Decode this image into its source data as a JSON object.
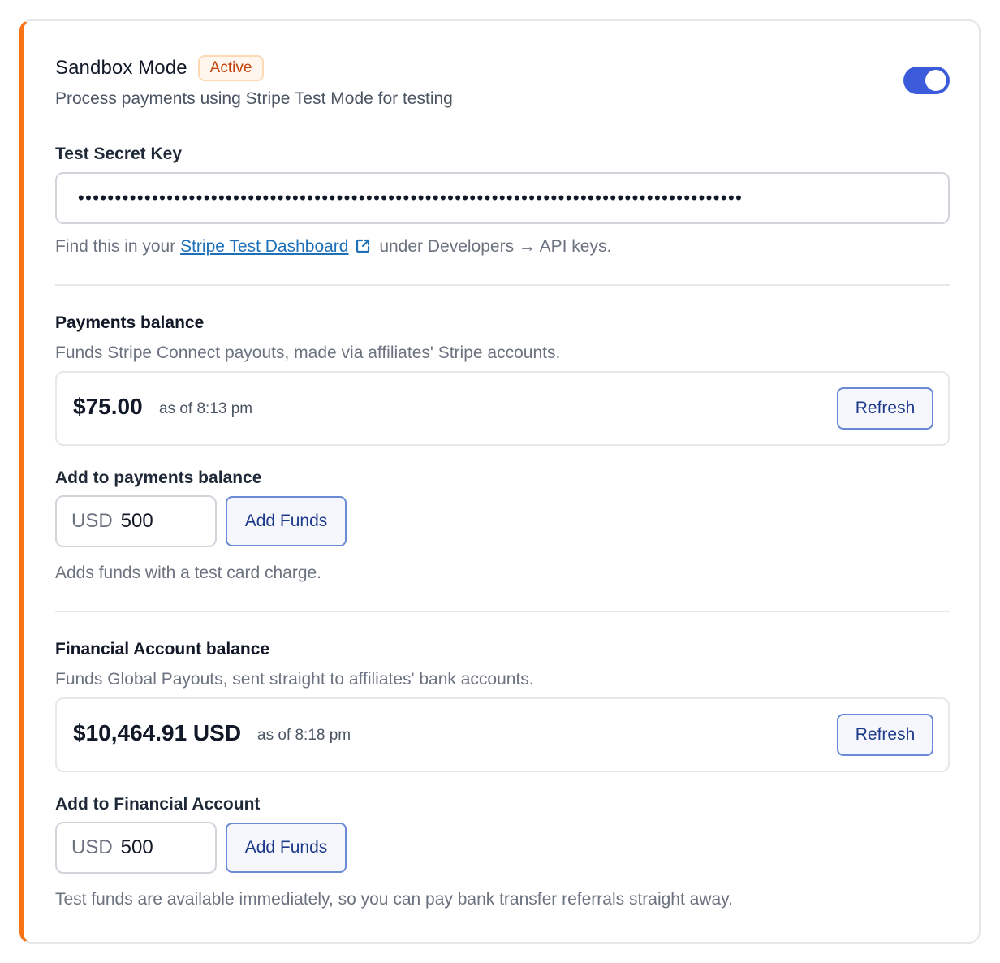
{
  "sandbox": {
    "title": "Sandbox Mode",
    "badge": "Active",
    "description": "Process payments using Stripe Test Mode for testing",
    "toggle_on": true
  },
  "secret_key": {
    "label": "Test Secret Key",
    "value": "••••••••••••••••••••••••••••••••••••••••••••••••••••••••••••••••••••••••••••••••••••••••••",
    "help_prefix": "Find this in your ",
    "help_link": "Stripe Test Dashboard",
    "help_suffix": " under Developers → API keys."
  },
  "payments_balance": {
    "title": "Payments balance",
    "description": "Funds Stripe Connect payouts, made via affiliates' Stripe accounts.",
    "amount": "$75.00",
    "as_of": "as of 8:13 pm",
    "refresh_label": "Refresh",
    "add_label": "Add to payments balance",
    "currency": "USD",
    "input_value": "500",
    "add_button": "Add Funds",
    "note": "Adds funds with a test card charge."
  },
  "financial_account": {
    "title": "Financial Account balance",
    "description": "Funds Global Payouts, sent straight to affiliates' bank accounts.",
    "amount": "$10,464.91 USD",
    "as_of": "as of 8:18 pm",
    "refresh_label": "Refresh",
    "add_label": "Add to Financial Account",
    "currency": "USD",
    "input_value": "500",
    "add_button": "Add Funds",
    "note": "Test funds are available immediately, so you can pay bank transfer referrals straight away."
  },
  "colors": {
    "accent_border": "#f97316",
    "toggle": "#3b5bdb",
    "link": "#1d6fb8",
    "badge_text": "#c2410c"
  }
}
